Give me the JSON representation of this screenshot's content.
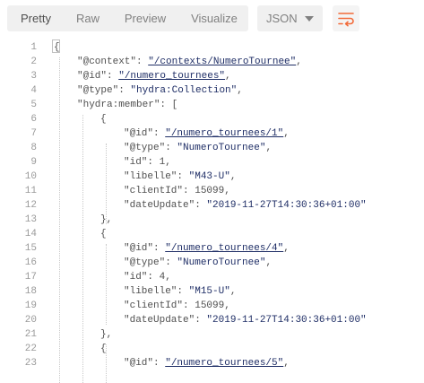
{
  "tabs": [
    {
      "label": "Pretty",
      "active": true
    },
    {
      "label": "Raw",
      "active": false
    },
    {
      "label": "Preview",
      "active": false
    },
    {
      "label": "Visualize",
      "active": false
    }
  ],
  "format": {
    "selected": "JSON"
  },
  "wrap_icon": "wrap-lines-icon",
  "colors": {
    "accent": "#f26b3a",
    "string": "#1f2e66",
    "text": "#505050"
  },
  "lines": [
    {
      "n": "1",
      "indent": 0,
      "parts": [
        [
          "p",
          "{"
        ]
      ]
    },
    {
      "n": "2",
      "indent": 1,
      "parts": [
        [
          "k",
          "\"@context\""
        ],
        [
          "p",
          ": "
        ],
        [
          "u",
          "\"/contexts/NumeroTournee\""
        ],
        [
          "p",
          ","
        ]
      ]
    },
    {
      "n": "3",
      "indent": 1,
      "parts": [
        [
          "k",
          "\"@id\""
        ],
        [
          "p",
          ": "
        ],
        [
          "u",
          "\"/numero_tournees\""
        ],
        [
          "p",
          ","
        ]
      ]
    },
    {
      "n": "4",
      "indent": 1,
      "parts": [
        [
          "k",
          "\"@type\""
        ],
        [
          "p",
          ": "
        ],
        [
          "s",
          "\"hydra:Collection\""
        ],
        [
          "p",
          ","
        ]
      ]
    },
    {
      "n": "5",
      "indent": 1,
      "parts": [
        [
          "k",
          "\"hydra:member\""
        ],
        [
          "p",
          ": ["
        ]
      ]
    },
    {
      "n": "6",
      "indent": 2,
      "parts": [
        [
          "p",
          "{"
        ]
      ]
    },
    {
      "n": "7",
      "indent": 3,
      "parts": [
        [
          "k",
          "\"@id\""
        ],
        [
          "p",
          ": "
        ],
        [
          "u",
          "\"/numero_tournees/1\""
        ],
        [
          "p",
          ","
        ]
      ]
    },
    {
      "n": "8",
      "indent": 3,
      "parts": [
        [
          "k",
          "\"@type\""
        ],
        [
          "p",
          ": "
        ],
        [
          "s",
          "\"NumeroTournee\""
        ],
        [
          "p",
          ","
        ]
      ]
    },
    {
      "n": "9",
      "indent": 3,
      "parts": [
        [
          "k",
          "\"id\""
        ],
        [
          "p",
          ": "
        ],
        [
          "n",
          "1"
        ],
        [
          "p",
          ","
        ]
      ]
    },
    {
      "n": "10",
      "indent": 3,
      "parts": [
        [
          "k",
          "\"libelle\""
        ],
        [
          "p",
          ": "
        ],
        [
          "s",
          "\"M43-U\""
        ],
        [
          "p",
          ","
        ]
      ]
    },
    {
      "n": "11",
      "indent": 3,
      "parts": [
        [
          "k",
          "\"clientId\""
        ],
        [
          "p",
          ": "
        ],
        [
          "n",
          "15099"
        ],
        [
          "p",
          ","
        ]
      ]
    },
    {
      "n": "12",
      "indent": 3,
      "parts": [
        [
          "k",
          "\"dateUpdate\""
        ],
        [
          "p",
          ": "
        ],
        [
          "s",
          "\"2019-11-27T14:30:36+01:00\""
        ]
      ]
    },
    {
      "n": "13",
      "indent": 2,
      "parts": [
        [
          "p",
          "},"
        ]
      ]
    },
    {
      "n": "14",
      "indent": 2,
      "parts": [
        [
          "p",
          "{"
        ]
      ]
    },
    {
      "n": "15",
      "indent": 3,
      "parts": [
        [
          "k",
          "\"@id\""
        ],
        [
          "p",
          ": "
        ],
        [
          "u",
          "\"/numero_tournees/4\""
        ],
        [
          "p",
          ","
        ]
      ]
    },
    {
      "n": "16",
      "indent": 3,
      "parts": [
        [
          "k",
          "\"@type\""
        ],
        [
          "p",
          ": "
        ],
        [
          "s",
          "\"NumeroTournee\""
        ],
        [
          "p",
          ","
        ]
      ]
    },
    {
      "n": "17",
      "indent": 3,
      "parts": [
        [
          "k",
          "\"id\""
        ],
        [
          "p",
          ": "
        ],
        [
          "n",
          "4"
        ],
        [
          "p",
          ","
        ]
      ]
    },
    {
      "n": "18",
      "indent": 3,
      "parts": [
        [
          "k",
          "\"libelle\""
        ],
        [
          "p",
          ": "
        ],
        [
          "s",
          "\"M15-U\""
        ],
        [
          "p",
          ","
        ]
      ]
    },
    {
      "n": "19",
      "indent": 3,
      "parts": [
        [
          "k",
          "\"clientId\""
        ],
        [
          "p",
          ": "
        ],
        [
          "n",
          "15099"
        ],
        [
          "p",
          ","
        ]
      ]
    },
    {
      "n": "20",
      "indent": 3,
      "parts": [
        [
          "k",
          "\"dateUpdate\""
        ],
        [
          "p",
          ": "
        ],
        [
          "s",
          "\"2019-11-27T14:30:36+01:00\""
        ]
      ]
    },
    {
      "n": "21",
      "indent": 2,
      "parts": [
        [
          "p",
          "},"
        ]
      ]
    },
    {
      "n": "22",
      "indent": 2,
      "parts": [
        [
          "p",
          "{"
        ]
      ]
    },
    {
      "n": "23",
      "indent": 3,
      "parts": [
        [
          "k",
          "\"@id\""
        ],
        [
          "p",
          ": "
        ],
        [
          "u",
          "\"/numero_tournees/5\""
        ],
        [
          "p",
          ","
        ]
      ]
    }
  ]
}
